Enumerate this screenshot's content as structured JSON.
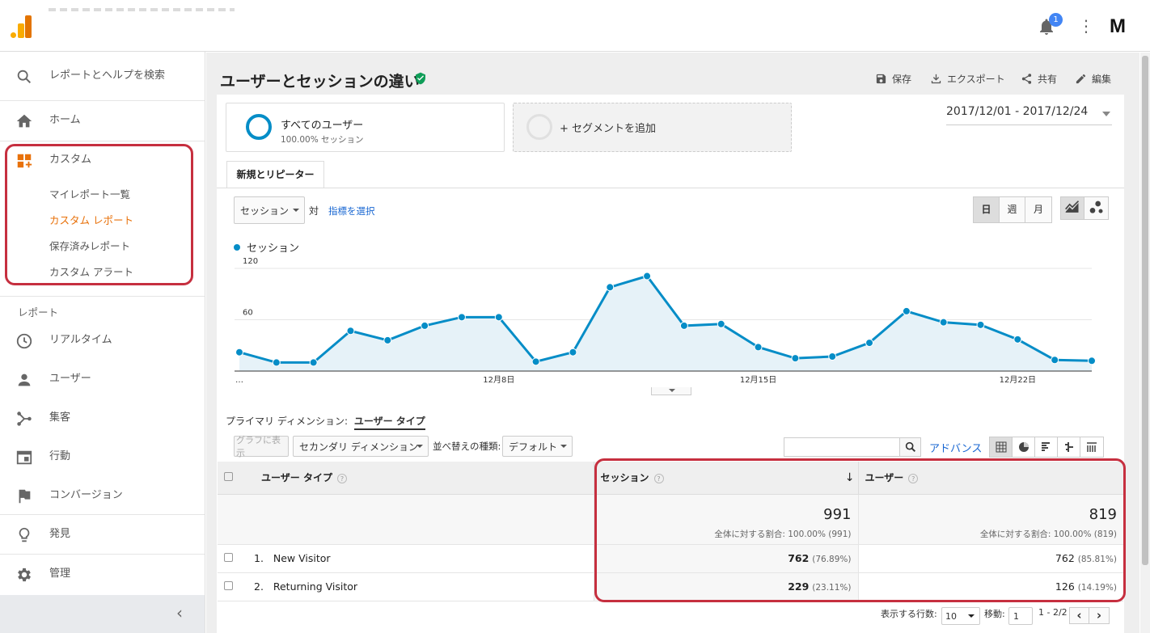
{
  "topbar": {
    "notification_count": "1",
    "avatar_letter": "M"
  },
  "sidebar": {
    "search": "レポートとヘルプを検索",
    "home": "ホーム",
    "custom": {
      "label": "カスタム",
      "items": [
        "マイレポート一覧",
        "カスタム レポート",
        "保存済みレポート",
        "カスタム アラート"
      ],
      "active_index": 1
    },
    "reports_section": "レポート",
    "items": [
      "リアルタイム",
      "ユーザー",
      "集客",
      "行動",
      "コンバージョン"
    ],
    "discover": "発見",
    "admin": "管理",
    "colors": {
      "active": "#e8710a",
      "highlight_box": "#c62f3f"
    }
  },
  "report": {
    "title": "ユーザーとセッションの違い",
    "actions": [
      "保存",
      "エクスポート",
      "共有",
      "編集"
    ],
    "segment1": {
      "name": "すべてのユーザー",
      "sub": "100.00% セッション"
    },
    "segment2": "+ セグメントを追加",
    "date_range": "2017/12/01 - 2017/12/24",
    "tab": "新規とリピーター",
    "metric_select": "セッション",
    "vs": "対",
    "choose_metric": "指標を選択",
    "granularity": [
      "日",
      "週",
      "月"
    ],
    "granularity_selected": 0,
    "legend": "セッション",
    "primary_dimension_label": "プライマリ ディメンション:",
    "primary_dimension_value": "ユーザー タイプ",
    "plot_button": "グラフに表示",
    "secondary_dimension": "セカンダリ ディメンション",
    "sort_label": "並べ替えの種類:",
    "sort_value": "デフォルト",
    "advanced": "アドバンス",
    "search_value": ""
  },
  "chart_data": {
    "type": "area",
    "series": [
      {
        "name": "セッション",
        "values": [
          22,
          10,
          10,
          47,
          36,
          53,
          63,
          63,
          11,
          22,
          98,
          111,
          53,
          55,
          28,
          15,
          17,
          33,
          70,
          57,
          54,
          37,
          13,
          12
        ]
      }
    ],
    "x": [
      "12/1",
      "12/2",
      "12/3",
      "12/4",
      "12/5",
      "12/6",
      "12/7",
      "12/8",
      "12/9",
      "12/10",
      "12/11",
      "12/12",
      "12/13",
      "12/14",
      "12/15",
      "12/16",
      "12/17",
      "12/18",
      "12/19",
      "12/20",
      "12/21",
      "12/22",
      "12/23",
      "12/24"
    ],
    "x_tick_labels": [
      {
        "label": "…",
        "index": 0
      },
      {
        "label": "12月8日",
        "index": 7
      },
      {
        "label": "12月15日",
        "index": 14
      },
      {
        "label": "12月22日",
        "index": 21
      }
    ],
    "y_ticks": [
      "60",
      "120"
    ],
    "ylim": [
      0,
      120
    ],
    "color": "#058dc7",
    "grid": true
  },
  "table": {
    "columns": {
      "dimension": "ユーザー タイプ",
      "sessions": "セッション",
      "users": "ユーザー"
    },
    "totals": {
      "sessions": "991",
      "sessions_sub": "全体に対する割合: 100.00% (991)",
      "users": "819",
      "users_sub": "全体に対する割合: 100.00% (819)"
    },
    "rows": [
      {
        "idx": "1.",
        "name": "New Visitor",
        "sessions": "762",
        "sessions_pct": "(76.89%)",
        "users": "762",
        "users_pct": "(85.81%)"
      },
      {
        "idx": "2.",
        "name": "Returning Visitor",
        "sessions": "229",
        "sessions_pct": "(23.11%)",
        "users": "126",
        "users_pct": "(14.19%)"
      }
    ]
  },
  "pager": {
    "rows_label": "表示する行数:",
    "rows_value": "10",
    "goto_label": "移動:",
    "goto_value": "1",
    "range": "1 - 2/2"
  }
}
